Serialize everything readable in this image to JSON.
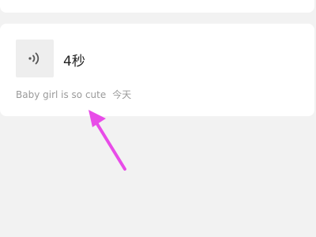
{
  "voice_message": {
    "duration_label": "4秒",
    "title": "Baby girl is so cute",
    "date": "今天",
    "icon": "voice-wave-icon"
  },
  "annotation": {
    "icon": "pointer-arrow-icon",
    "color": "#e84ce8"
  },
  "colors": {
    "page_background": "#f2f2f2",
    "card_background": "#ffffff",
    "icon_box_background": "#eeeeee",
    "meta_text": "#9a9a9a"
  }
}
